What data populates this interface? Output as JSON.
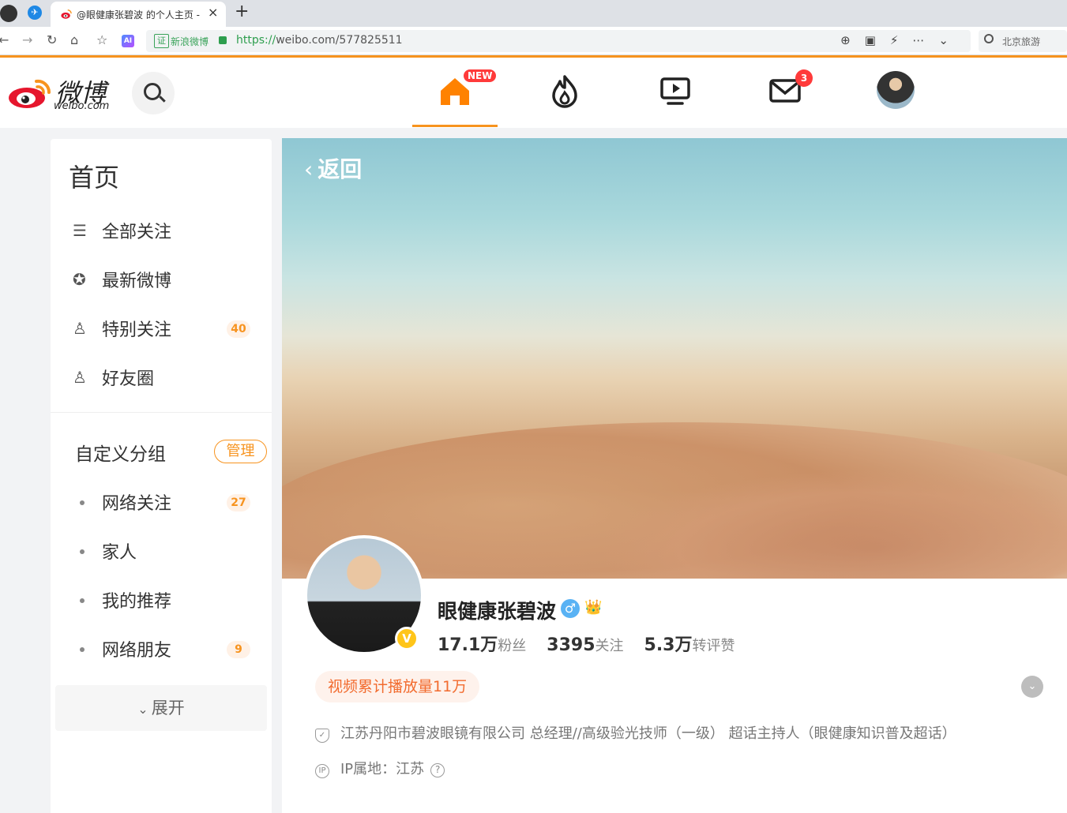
{
  "browser": {
    "tab_title": "@眼健康张碧波 的个人主页 -",
    "address_cert": "证",
    "address_site_name": "新浪微博",
    "url_scheme": "https://",
    "url_rest": "weibo.com/577825511",
    "search_placeholder": "北京旅游"
  },
  "header": {
    "logo_text": "微博",
    "logo_subtext": "weibo.com",
    "home_badge": "NEW",
    "messages_badge": "3",
    "active_nav": "home"
  },
  "sidebar": {
    "title": "首页",
    "main_items": [
      {
        "label": "全部关注",
        "icon": "list-icon"
      },
      {
        "label": "最新微博",
        "icon": "star-circle-icon"
      },
      {
        "label": "特别关注",
        "icon": "user-heart-icon",
        "count": "40"
      },
      {
        "label": "好友圈",
        "icon": "user-friends-icon"
      }
    ],
    "group_title": "自定义分组",
    "manage_label": "管理",
    "groups": [
      {
        "label": "网络关注",
        "count": "27"
      },
      {
        "label": "家人"
      },
      {
        "label": "我的推荐"
      },
      {
        "label": "网络朋友",
        "count": "9"
      }
    ],
    "expand_label": "展开"
  },
  "profile": {
    "back_label": "返回",
    "name": "眼健康张碧波",
    "gender_symbol": "♂",
    "verified_mark": "V",
    "stats": [
      {
        "value": "17.1万",
        "unit": "粉丝"
      },
      {
        "value": "3395",
        "unit": "关注"
      },
      {
        "value": "5.3万",
        "unit": "转评赞"
      }
    ],
    "highlight": "视频累计播放量11万",
    "bio": "江苏丹阳市碧波眼镜有限公司 总经理//高级验光技师（一级） 超话主持人（眼健康知识普及超话）",
    "ip_label": "IP属地：江苏",
    "ip_icon_text": "IP"
  },
  "colors": {
    "accent": "#f7931e",
    "badge_red": "#ff3a3a",
    "pill_text": "#f26b2e"
  }
}
